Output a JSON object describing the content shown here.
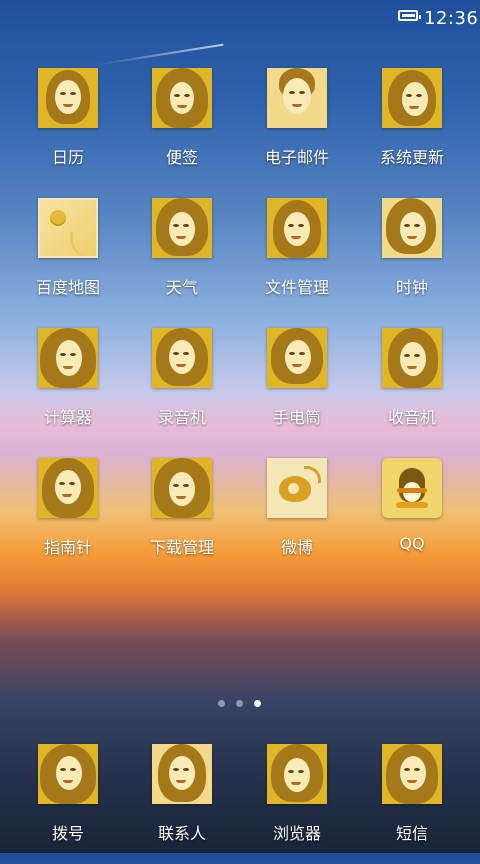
{
  "status_bar": {
    "time": "12:36",
    "battery_icon": "battery-icon"
  },
  "grid": {
    "apps": [
      {
        "label": "日历",
        "icon": "calendar-icon"
      },
      {
        "label": "便签",
        "icon": "notes-icon"
      },
      {
        "label": "电子邮件",
        "icon": "email-icon"
      },
      {
        "label": "系统更新",
        "icon": "system-update-icon"
      },
      {
        "label": "百度地图",
        "icon": "baidu-map-icon"
      },
      {
        "label": "天气",
        "icon": "weather-icon"
      },
      {
        "label": "文件管理",
        "icon": "file-manager-icon"
      },
      {
        "label": "时钟",
        "icon": "clock-icon"
      },
      {
        "label": "计算器",
        "icon": "calculator-icon"
      },
      {
        "label": "录音机",
        "icon": "recorder-icon"
      },
      {
        "label": "手电筒",
        "icon": "flashlight-icon"
      },
      {
        "label": "收音机",
        "icon": "radio-icon"
      },
      {
        "label": "指南针",
        "icon": "compass-icon"
      },
      {
        "label": "下载管理",
        "icon": "download-manager-icon"
      },
      {
        "label": "微博",
        "icon": "weibo-icon"
      },
      {
        "label": "QQ",
        "icon": "qq-icon"
      }
    ]
  },
  "page_indicator": {
    "pages": 3,
    "active_page": 3
  },
  "dock": {
    "apps": [
      {
        "label": "拨号",
        "icon": "dialer-icon"
      },
      {
        "label": "联系人",
        "icon": "contacts-icon"
      },
      {
        "label": "浏览器",
        "icon": "browser-icon"
      },
      {
        "label": "短信",
        "icon": "messages-icon"
      }
    ]
  },
  "colors": {
    "tile_gold": "#e0b627",
    "label_text": "#ffffff"
  }
}
